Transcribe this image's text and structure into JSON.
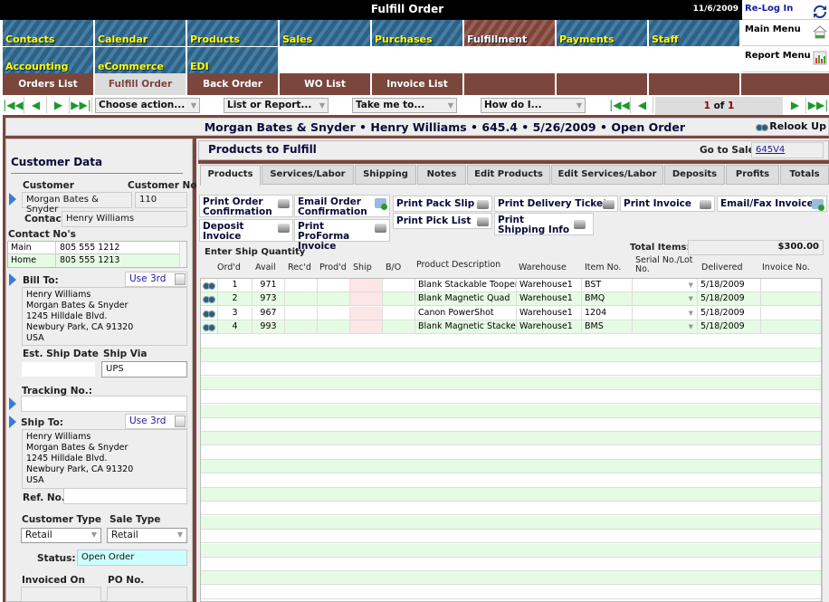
{
  "window": {
    "title": "Fulfill Order",
    "date": "11/6/2009"
  },
  "side_menu": [
    {
      "label": "Re-Log In",
      "icon": "refresh-icon",
      "color": "#1a1aa0"
    },
    {
      "label": "Main Menu",
      "icon": "house-icon",
      "color": "#111111"
    },
    {
      "label": "Report Menu",
      "icon": "chart-icon",
      "color": "#111111"
    }
  ],
  "modules": [
    {
      "label": "Contacts"
    },
    {
      "label": "Calendar"
    },
    {
      "label": "Products"
    },
    {
      "label": "Sales"
    },
    {
      "label": "Purchases"
    },
    {
      "label": "Fulfillment",
      "active": true
    },
    {
      "label": "Payments"
    },
    {
      "label": "Staff"
    },
    {
      "label": "Accounting"
    },
    {
      "label": "eCommerce"
    },
    {
      "label": "EDI"
    }
  ],
  "subtabs": [
    {
      "label": "Orders List"
    },
    {
      "label": "Fulfill Order",
      "selected": true
    },
    {
      "label": "Back Order"
    },
    {
      "label": "WO List"
    },
    {
      "label": "Invoice List"
    }
  ],
  "toolbar": {
    "first_icon": "first-record-icon",
    "prev_icon": "prev-record-icon",
    "next_icon": "next-record-icon",
    "last_icon": "last-record-icon",
    "dropdowns": [
      "Choose action...",
      "List or Report...",
      "Take me to...",
      "How do I..."
    ],
    "pager": {
      "current": "1",
      "of_label": "of",
      "total": "1"
    }
  },
  "record_header": {
    "summary": "Morgan Bates & Snyder  •  Henry Williams  •  645.4  •  5/26/2009  •  Open Order",
    "relook_label": "Relook Up"
  },
  "customer": {
    "section_title": "Customer Data",
    "customer_label": "Customer",
    "customer_value": "Morgan Bates & Snyder",
    "customer_no_label": "Customer No.",
    "customer_no_value": "110",
    "contact_label": "Contact:",
    "contact_value": "Henry Williams",
    "contact_nos_label": "Contact No's",
    "contact_nos": [
      {
        "type": "Main",
        "number": "805 555 1212"
      },
      {
        "type": "Home",
        "number": "805 555 1213"
      }
    ],
    "bill_to_label": "Bill To:",
    "use3rd_label": "Use 3rd",
    "bill_to_lines": [
      "Henry Williams",
      "Morgan Bates & Snyder",
      "1245 Hilldale Blvd.",
      "Newbury Park, CA 91320",
      "USA"
    ],
    "est_ship_date_label": "Est. Ship Date",
    "est_ship_date_value": "",
    "ship_via_label": "Ship Via",
    "ship_via_value": "UPS",
    "tracking_label": "Tracking No.:",
    "tracking_value": "",
    "ship_to_label": "Ship To:",
    "ship_to_lines": [
      "Henry Williams",
      "Morgan Bates & Snyder",
      "1245 Hilldale Blvd.",
      "Newbury Park, CA 91320",
      "USA"
    ],
    "ref_no_label": "Ref. No.",
    "ref_no_value": "",
    "customer_type_label": "Customer Type",
    "customer_type_value": "Retail",
    "sale_type_label": "Sale Type",
    "sale_type_value": "Retail",
    "status_label": "Status:",
    "status_value": "Open Order",
    "status_color": "#ccffff",
    "invoiced_on_label": "Invoiced On",
    "po_no_label": "PO No."
  },
  "main": {
    "title": "Products to Fulfill",
    "go_to_sale_label": "Go to Sale",
    "go_to_sale_value": "645V4",
    "tabs": [
      "Products",
      "Services/Labor",
      "Shipping",
      "Notes",
      "Edit Products",
      "Edit Services/Labor",
      "Deposits",
      "Profits",
      "Totals"
    ],
    "print_buttons": [
      {
        "label": "Print Order Confirmation",
        "icon": "printer-icon"
      },
      {
        "label": "Email Order Confirmation",
        "icon": "email-icon"
      },
      {
        "label": "Print Pack Slip",
        "icon": "printer-icon"
      },
      {
        "label": "Print Delivery Ticket",
        "icon": "printer-icon"
      },
      {
        "label": "Print Invoice",
        "icon": "printer-icon"
      },
      {
        "label": "Email/Fax Invoice",
        "icon": "email-icon"
      },
      {
        "label": "Deposit Invoice",
        "icon": "printer-icon"
      },
      {
        "label": "Print ProForma Invoice",
        "icon": "printer-icon"
      },
      {
        "label": "Print Pick List",
        "icon": "printer-icon"
      },
      {
        "label": "Print Shipping Info",
        "icon": "printer-icon"
      }
    ],
    "enter_ship_qty_label": "Enter  Ship Quantity",
    "total_items_label": "Total Items:",
    "total_items_value": "$300.00",
    "columns": [
      "Ord'd",
      "Avail",
      "Rec'd",
      "Prod'd",
      "Ship",
      "B/O",
      "Product Description",
      "Warehouse",
      "Item No.",
      "Serial No./Lot No.",
      "Delivered",
      "Invoice No."
    ],
    "rows": [
      {
        "ordd": "1",
        "avail": "971",
        "recd": "",
        "prodd": "",
        "ship": "",
        "bo": "",
        "desc": "Blank Stackable Tooper",
        "warehouse": "Warehouse1",
        "item": "BST",
        "serial": "",
        "delivered": "5/18/2009",
        "invoice": ""
      },
      {
        "ordd": "2",
        "avail": "973",
        "recd": "",
        "prodd": "",
        "ship": "",
        "bo": "",
        "desc": "Blank Magnetic Quad",
        "warehouse": "Warehouse1",
        "item": "BMQ",
        "serial": "",
        "delivered": "5/18/2009",
        "invoice": ""
      },
      {
        "ordd": "3",
        "avail": "967",
        "recd": "",
        "prodd": "",
        "ship": "",
        "bo": "",
        "desc": "Canon PowerShot",
        "warehouse": "Warehouse1",
        "item": "1204",
        "serial": "",
        "delivered": "5/18/2009",
        "invoice": ""
      },
      {
        "ordd": "4",
        "avail": "993",
        "recd": "",
        "prodd": "",
        "ship": "",
        "bo": "",
        "desc": "Blank Magnetic Stacker",
        "warehouse": "Warehouse1",
        "item": "BMS",
        "serial": "",
        "delivered": "5/18/2009",
        "invoice": ""
      }
    ]
  },
  "colors": {
    "brand_brown": "#7b463c",
    "module_blue": "#2f6a94",
    "module_label": "#ffff00",
    "row_alt": "#e6fbe4",
    "ship_cell": "#fde6e6"
  }
}
